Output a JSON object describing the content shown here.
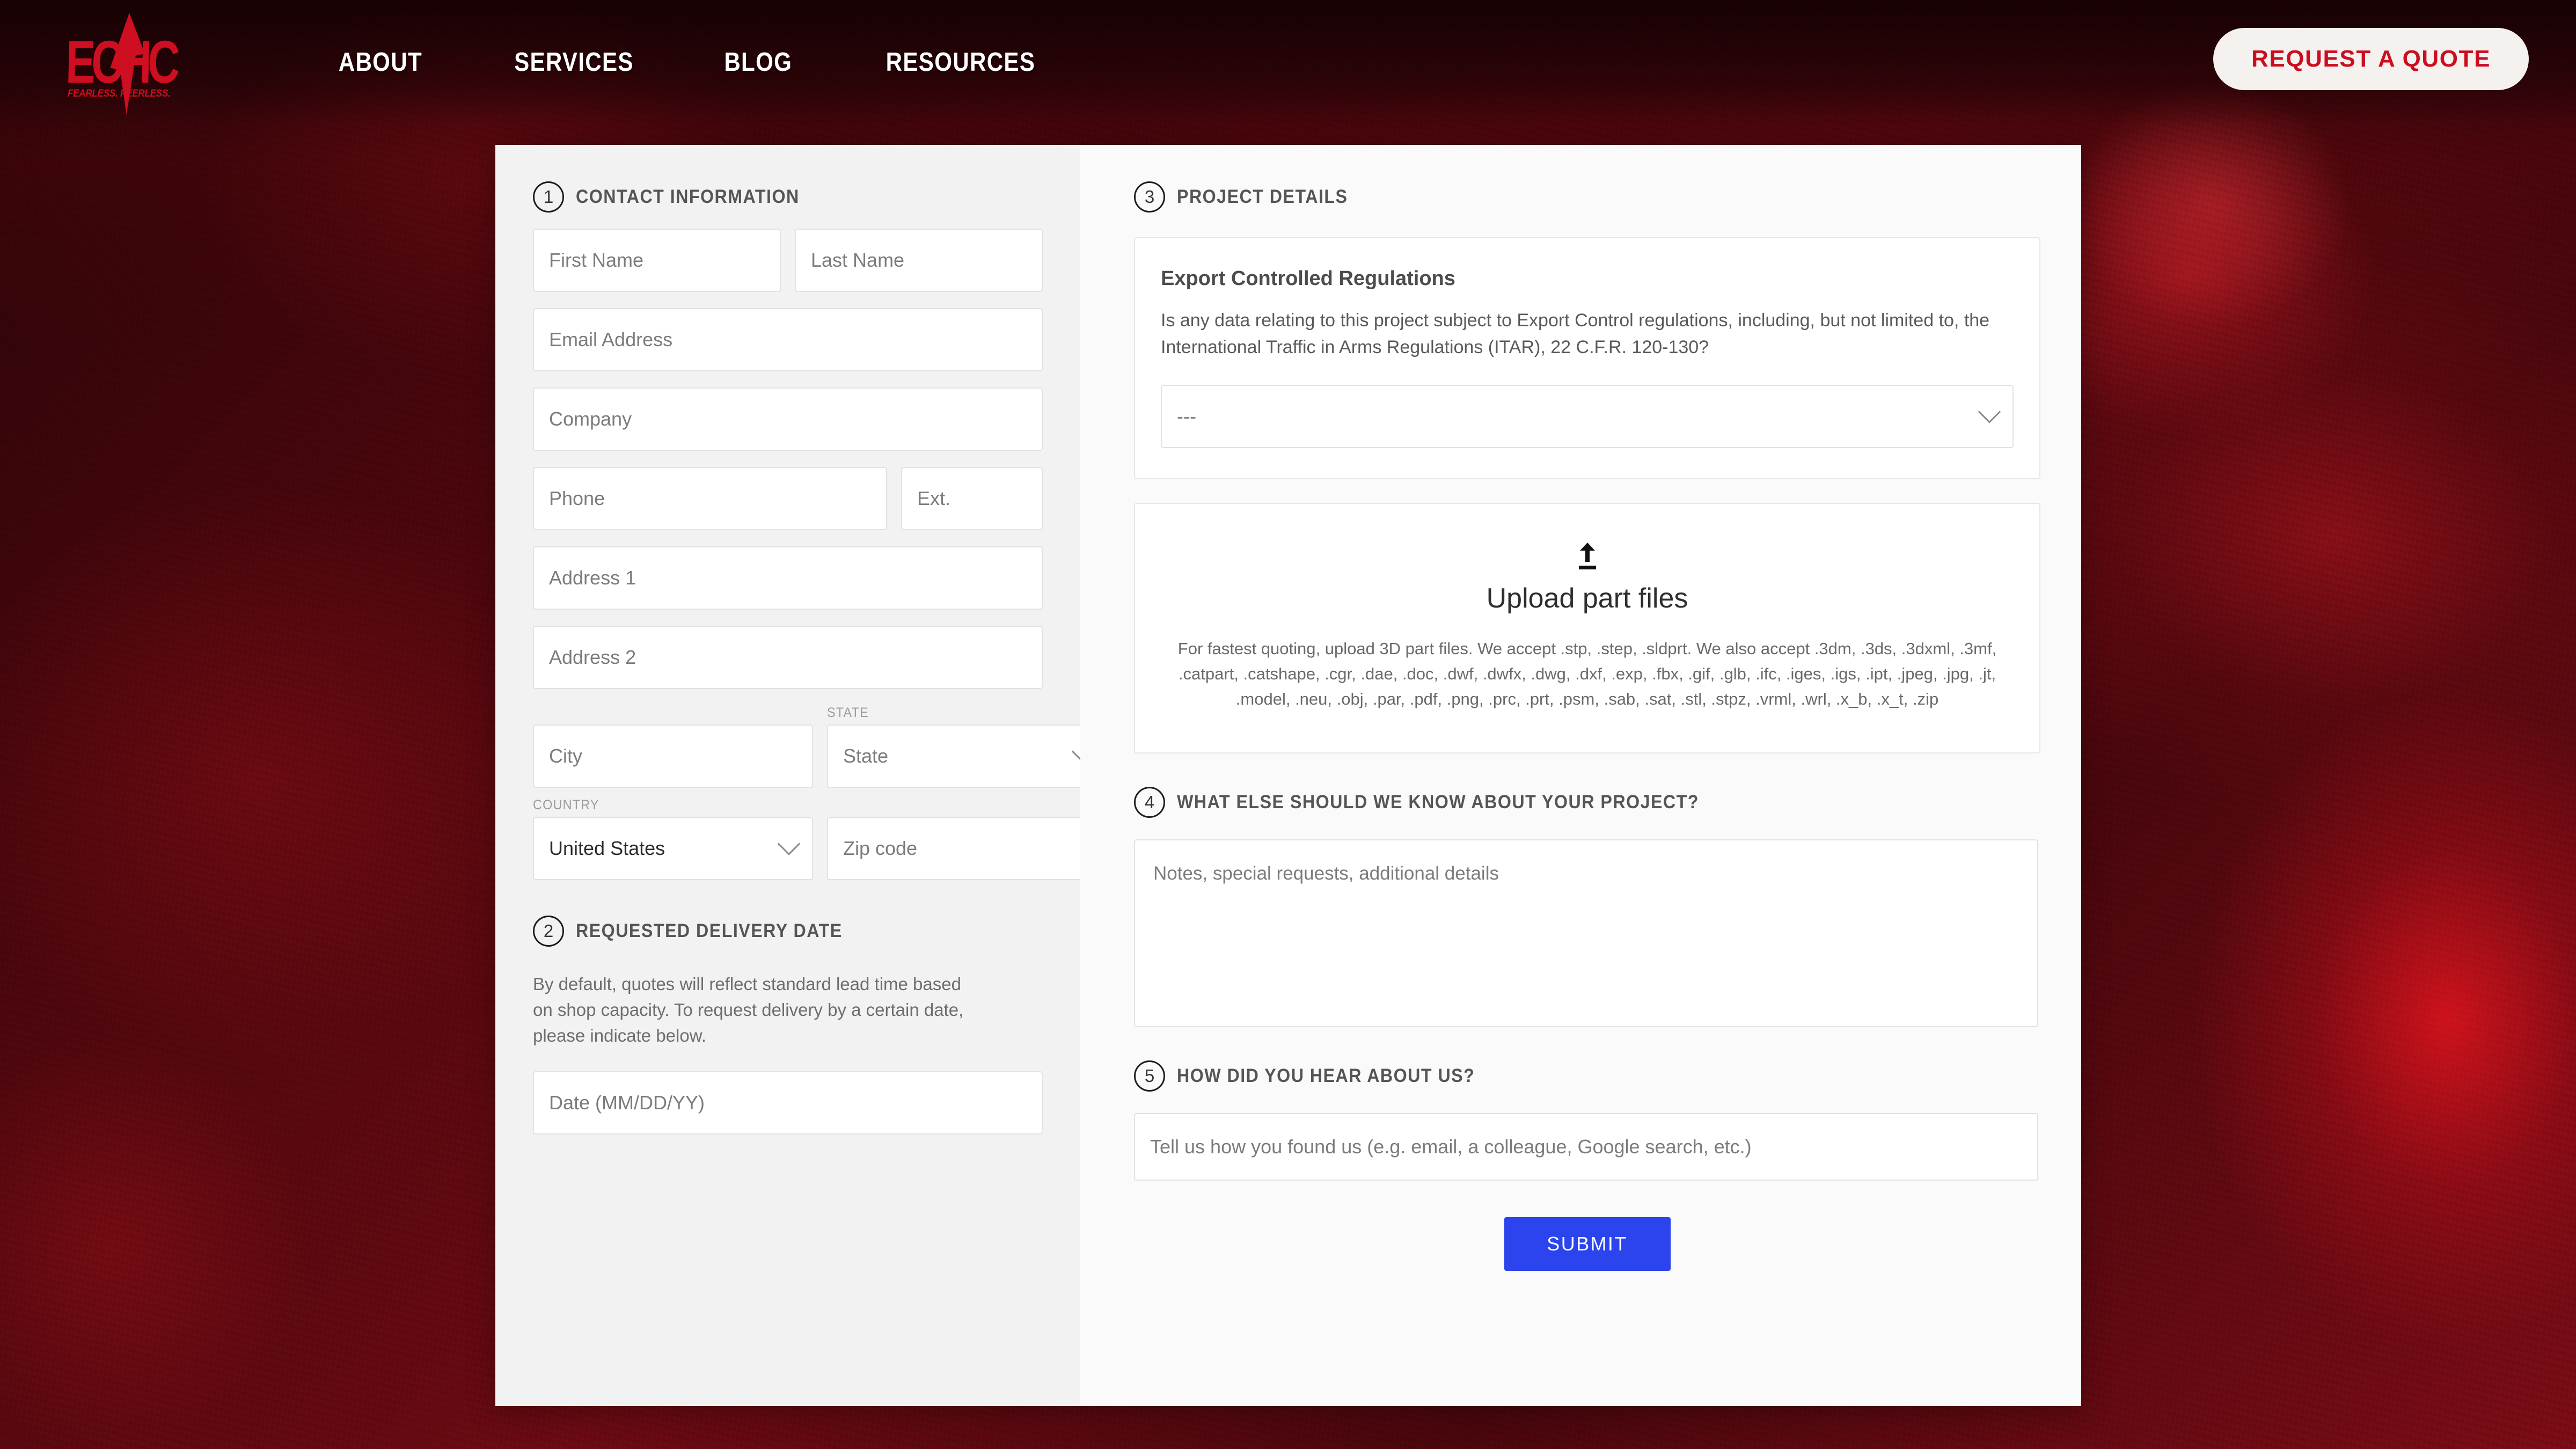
{
  "brand": {
    "logo_text": "ECHC",
    "logo_tagline": "FEARLESS. PEERLESS.",
    "accent_red": "#CE0E21",
    "button_cream": "#F4F1EE",
    "submit_blue": "#2B44EE"
  },
  "header": {
    "nav": [
      {
        "label": "ABOUT"
      },
      {
        "label": "SERVICES"
      },
      {
        "label": "BLOG"
      },
      {
        "label": "RESOURCES"
      }
    ],
    "cta_label": "REQUEST A QUOTE"
  },
  "form": {
    "section1": {
      "number": "1",
      "title": "CONTACT INFORMATION",
      "first_name_placeholder": "First Name",
      "last_name_placeholder": "Last Name",
      "email_placeholder": "Email Address",
      "company_placeholder": "Company",
      "phone_placeholder": "Phone",
      "ext_placeholder": "Ext.",
      "address1_placeholder": "Address 1",
      "address2_placeholder": "Address 2",
      "city_placeholder": "City",
      "state_label": "STATE",
      "state_value": "State",
      "country_label": "COUNTRY",
      "country_value": "United States",
      "zip_placeholder": "Zip code"
    },
    "section2": {
      "number": "2",
      "title": "REQUESTED DELIVERY DATE",
      "help": "By default, quotes will reflect standard lead time based on shop capacity. To request delivery by a certain date, please indicate below.",
      "date_placeholder": "Date (MM/DD/YY)"
    },
    "section3": {
      "number": "3",
      "title": "PROJECT DETAILS",
      "export_card_title": "Export Controlled Regulations",
      "export_card_body": "Is any data relating to this project subject to Export Control regulations, including, but not limited to, the International Traffic in Arms Regulations (ITAR), 22 C.F.R. 120-130?",
      "export_select_value": "---",
      "upload_icon": "upload-arrow-icon",
      "upload_title": "Upload part files",
      "upload_desc": "For fastest quoting, upload 3D part files. We accept .stp, .step, .sldprt. We also accept .3dm, .3ds, .3dxml, .3mf, .catpart, .catshape, .cgr, .dae, .doc, .dwf, .dwfx, .dwg, .dxf, .exp, .fbx, .gif, .glb, .ifc, .iges, .igs, .ipt, .jpeg, .jpg, .jt, .model, .neu, .obj, .par, .pdf, .png, .prc, .prt, .psm, .sab, .sat, .stl, .stpz, .vrml, .wrl, .x_b, .x_t, .zip"
    },
    "section4": {
      "number": "4",
      "title": "WHAT ELSE SHOULD WE KNOW ABOUT YOUR PROJECT?",
      "notes_placeholder": "Notes, special requests, additional details"
    },
    "section5": {
      "number": "5",
      "title": "HOW DID YOU HEAR ABOUT US?",
      "hear_placeholder": "Tell us how you found us (e.g. email, a colleague, Google search, etc.)"
    },
    "submit_label": "SUBMIT"
  }
}
